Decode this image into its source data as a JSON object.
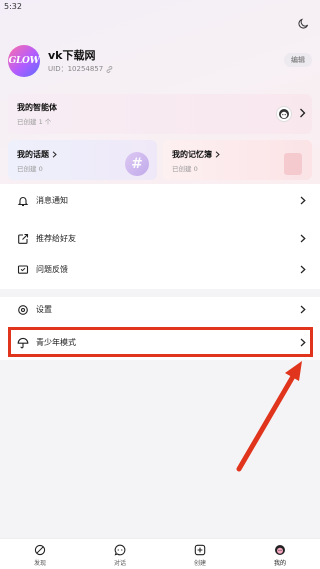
{
  "status_bar": {
    "time": "5:32"
  },
  "profile": {
    "avatar_text": "GLOW",
    "username": "vk下载网",
    "uid": "UID：10254857",
    "edit_label": "编辑"
  },
  "agent_card": {
    "title": "我的智能体",
    "subtitle": "已创建 1 个"
  },
  "topic_card": {
    "title": "我的话题",
    "subtitle": "已创建 0"
  },
  "memo_card": {
    "title": "我的记忆簿",
    "subtitle": "已创建 0"
  },
  "menu": {
    "notifications": "消息通知",
    "recommend": "推荐给好友",
    "feedback": "问题反馈",
    "settings": "设置",
    "youth_mode": "青少年模式"
  },
  "tabs": [
    {
      "label": "发现",
      "icon": "discover-icon"
    },
    {
      "label": "对话",
      "icon": "chat-icon"
    },
    {
      "label": "创建",
      "icon": "create-icon"
    },
    {
      "label": "我的",
      "icon": "profile-icon"
    }
  ],
  "colors": {
    "highlight": "#e0341c",
    "accent": "#b25cff"
  }
}
